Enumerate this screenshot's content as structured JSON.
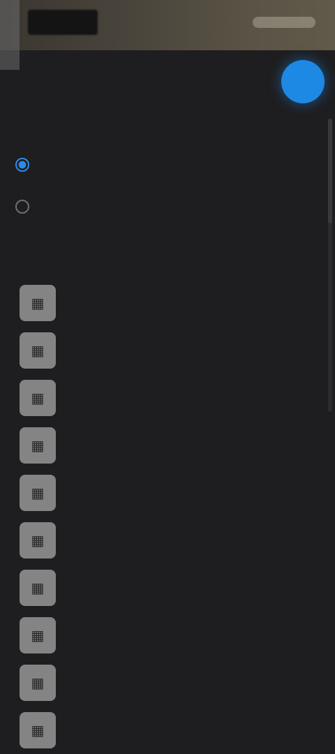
{
  "colors": {
    "accent": "#1e88e5",
    "background": "#1e1e20"
  },
  "header": {
    "back_icon": "panel-edge",
    "title": "",
    "actions_icon": "toolbar-icons"
  },
  "fab": {
    "icon": "circle-button-icon"
  },
  "mode": {
    "label": "",
    "options": [
      {
        "label": "",
        "selected": true
      },
      {
        "label": "",
        "selected": false
      }
    ]
  },
  "files": {
    "label": "",
    "items": [
      {
        "icon": "image-file-icon",
        "name": "",
        "meta": ""
      },
      {
        "icon": "image-file-icon",
        "name": "",
        "meta": ""
      },
      {
        "icon": "image-file-icon",
        "name": "",
        "meta": ""
      },
      {
        "icon": "image-file-icon",
        "name": "",
        "meta": ""
      },
      {
        "icon": "image-file-icon",
        "name": "",
        "meta": ""
      },
      {
        "icon": "image-file-icon",
        "name": "",
        "meta": ""
      },
      {
        "icon": "image-file-icon",
        "name": "",
        "meta": ""
      },
      {
        "icon": "image-file-icon",
        "name": "",
        "meta": ""
      },
      {
        "icon": "image-file-icon",
        "name": "",
        "meta": ""
      },
      {
        "icon": "image-file-icon",
        "name": "",
        "meta": ""
      }
    ]
  }
}
